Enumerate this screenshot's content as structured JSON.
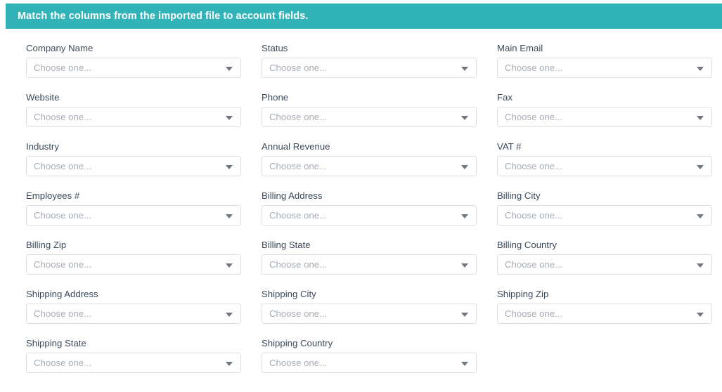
{
  "banner": {
    "title": "Match the columns from the imported file to account fields.",
    "background_color": "#31b3b8",
    "text_color": "#ffffff"
  },
  "form": {
    "placeholder": "Choose one...",
    "caret_icon": "chevron-down-icon",
    "label_color": "#3b4a5a",
    "placeholder_color": "#a6adb6",
    "border_color": "#dcdfe3",
    "columns": 3,
    "fields": [
      {
        "label": "Company Name",
        "value": "Choose one..."
      },
      {
        "label": "Status",
        "value": "Choose one..."
      },
      {
        "label": "Main Email",
        "value": "Choose one..."
      },
      {
        "label": "Website",
        "value": "Choose one..."
      },
      {
        "label": "Phone",
        "value": "Choose one..."
      },
      {
        "label": "Fax",
        "value": "Choose one..."
      },
      {
        "label": "Industry",
        "value": "Choose one..."
      },
      {
        "label": "Annual Revenue",
        "value": "Choose one..."
      },
      {
        "label": "VAT #",
        "value": "Choose one..."
      },
      {
        "label": "Employees #",
        "value": "Choose one..."
      },
      {
        "label": "Billing Address",
        "value": "Choose one..."
      },
      {
        "label": "Billing City",
        "value": "Choose one..."
      },
      {
        "label": "Billing Zip",
        "value": "Choose one..."
      },
      {
        "label": "Billing State",
        "value": "Choose one..."
      },
      {
        "label": "Billing Country",
        "value": "Choose one..."
      },
      {
        "label": "Shipping Address",
        "value": "Choose one..."
      },
      {
        "label": "Shipping City",
        "value": "Choose one..."
      },
      {
        "label": "Shipping Zip",
        "value": "Choose one..."
      },
      {
        "label": "Shipping State",
        "value": "Choose one..."
      },
      {
        "label": "Shipping Country",
        "value": "Choose one..."
      }
    ]
  }
}
